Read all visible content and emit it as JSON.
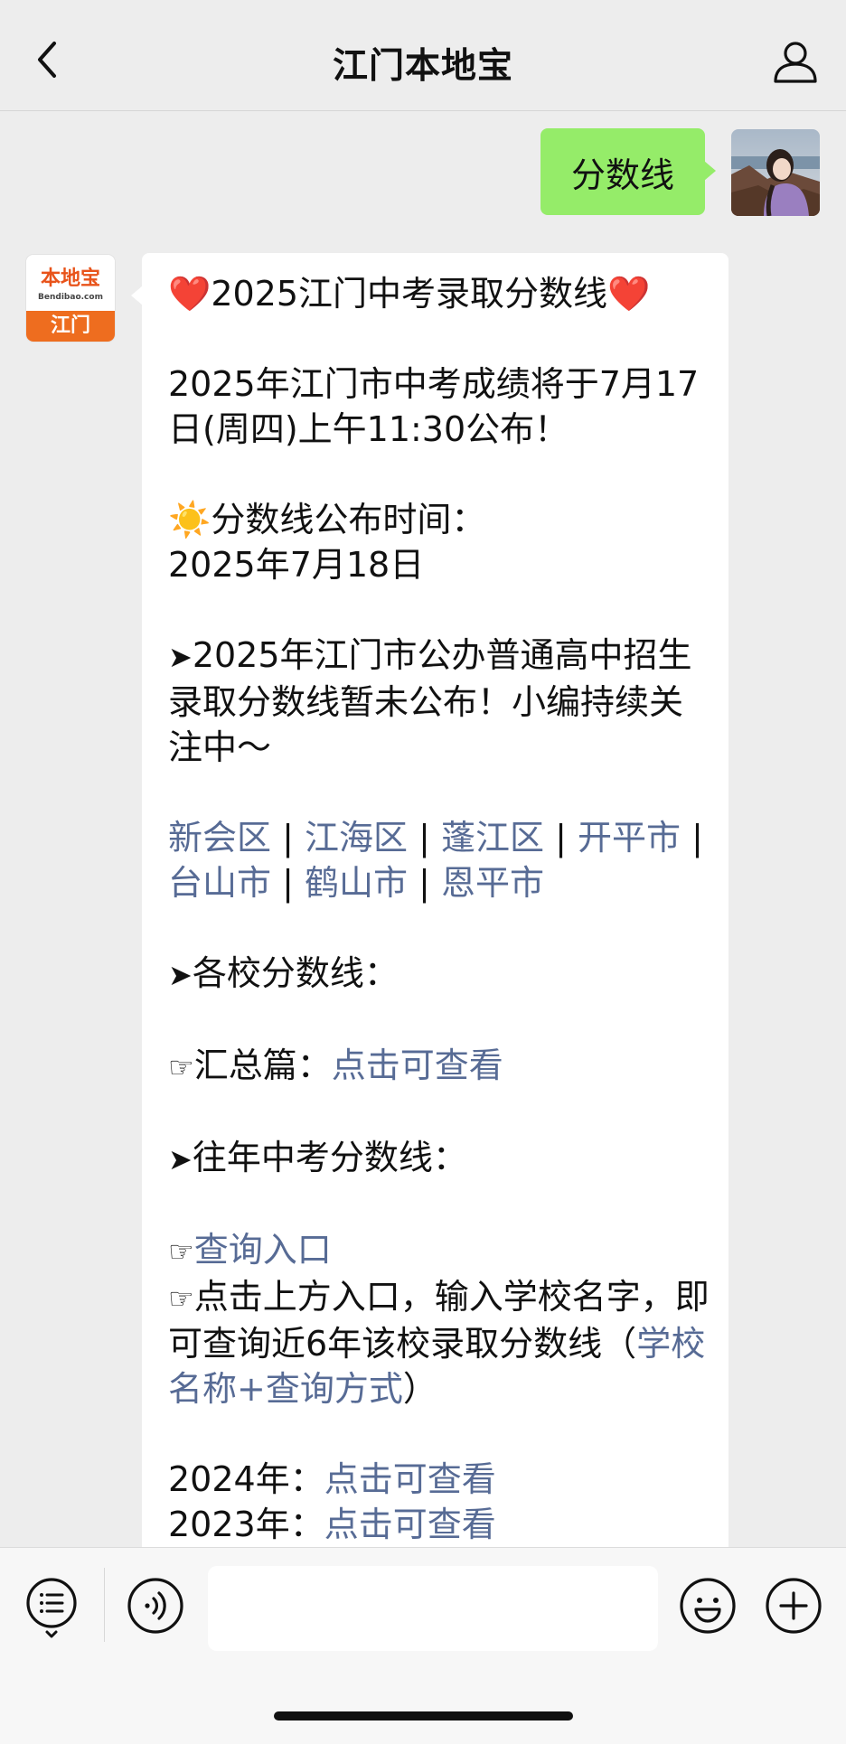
{
  "header": {
    "title": "江门本地宝"
  },
  "user_message": {
    "text": "分数线"
  },
  "bot_avatar": {
    "logo_name": "本地宝",
    "logo_url": "Bendibao.com",
    "logo_city": "江门"
  },
  "bot_message": {
    "heart": "❤️",
    "headline": "2025江门中考录取分数线",
    "announce": "2025年江门市中考成绩将于7月17日(周四)上午11:30公布！",
    "sun": "☀️",
    "release_label": "分数线公布时间：",
    "release_date": "2025年7月18日",
    "arrow": "➤",
    "pending_note": "2025年江门市公办普通高中招生录取分数线暂未公布！小编持续关注中～",
    "separator": "|",
    "districts": [
      "新会区",
      "江海区",
      "蓬江区",
      "开平市",
      "台山市",
      "鹤山市",
      "恩平市"
    ],
    "schools_heading": "各校分数线：",
    "hand": "☞",
    "summary_label": "汇总篇：",
    "click_to_view": "点击可查看",
    "past_heading": "往年中考分数线：",
    "query_link": "查询入口",
    "query_instruction": "点击上方入口，输入学校名字，即可查询近6年该校录取分数线（",
    "query_method_link": "学校名称+查询方式",
    "query_close": "）",
    "year_2024": "2024年：",
    "year_2023": "2023年："
  },
  "icons": {
    "back": "chevron-left-icon",
    "profile": "person-icon",
    "menu": "list-menu-icon",
    "voice": "voice-icon",
    "emoji": "smiley-icon",
    "plus": "plus-icon"
  },
  "colors": {
    "background": "#ededed",
    "user_bubble": "#95ec69",
    "link": "#576b95",
    "brand_orange": "#ee6d1f"
  }
}
